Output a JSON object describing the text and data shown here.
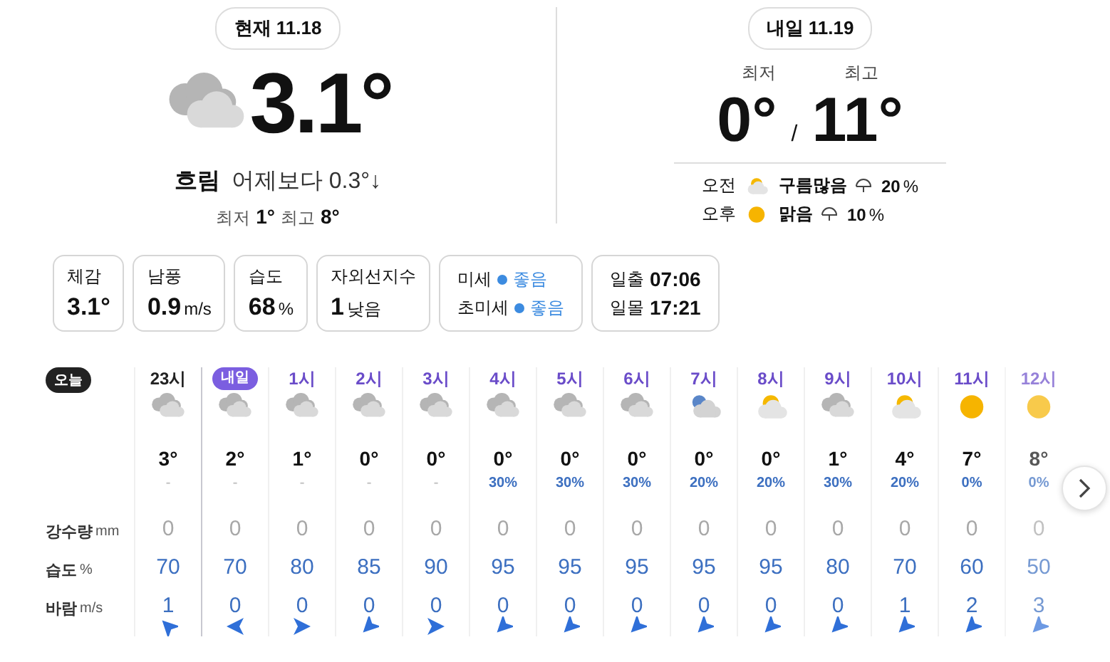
{
  "today": {
    "date_label": "현재 11.18",
    "temp": "3.1°",
    "icon": {
      "kind": "cloudy"
    },
    "condition": "흐림",
    "compare": "어제보다 0.3°↓",
    "low_label": "최저",
    "low": "1°",
    "high_label": "최고",
    "high": "8°"
  },
  "tomorrow": {
    "date_label": "내일 11.19",
    "low_label": "최저",
    "high_label": "최고",
    "low": "0°",
    "separator": "/",
    "high": "11°",
    "periods": [
      {
        "label": "오전",
        "icon": {
          "kind": "partly-cloudy"
        },
        "condition": "구름많음",
        "chance": "20",
        "unit": "%"
      },
      {
        "label": "오후",
        "icon": {
          "kind": "sunny"
        },
        "condition": "맑음",
        "chance": "10",
        "unit": "%"
      }
    ]
  },
  "cards": [
    {
      "kind": "single",
      "label": "체감",
      "value": "3.1°"
    },
    {
      "kind": "single",
      "label": "남풍",
      "value": "0.9",
      "unit": "m/s"
    },
    {
      "kind": "single",
      "label": "습도",
      "value": "68",
      "unit": "%"
    },
    {
      "kind": "single",
      "label": "자외선지수",
      "value": "1",
      "unit": "낮음"
    },
    {
      "kind": "air",
      "rows": [
        {
          "label": "미세",
          "value": "좋음"
        },
        {
          "label": "초미세",
          "value": "좋음"
        }
      ]
    },
    {
      "kind": "sun",
      "rows": [
        {
          "label": "일출",
          "value": "07:06"
        },
        {
          "label": "일몰",
          "value": "17:21"
        }
      ]
    }
  ],
  "hourly": {
    "day_tag": "오늘",
    "row_labels": [
      {
        "label": "강수량",
        "unit": "mm"
      },
      {
        "label": "습도",
        "unit": "%"
      },
      {
        "label": "바람",
        "unit": "m/s"
      }
    ],
    "columns": [
      {
        "kind": "hour",
        "time": "23시",
        "tomorrow": false,
        "faded": false,
        "icon": {
          "kind": "cloudy"
        },
        "temp": "3°",
        "chance": "-",
        "rain": "0",
        "humidity": "70",
        "wind": "1",
        "wind_arrow": {
          "kind": "nw"
        }
      },
      {
        "kind": "tag",
        "time": "내일",
        "faded": false,
        "icon": {
          "kind": "cloudy"
        },
        "temp": "2°",
        "chance": "-",
        "rain": "0",
        "humidity": "70",
        "wind": "0",
        "wind_arrow": {
          "kind": "w"
        }
      },
      {
        "kind": "hour",
        "time": "1시",
        "tomorrow": true,
        "faded": false,
        "icon": {
          "kind": "cloudy"
        },
        "temp": "1°",
        "chance": "-",
        "rain": "0",
        "humidity": "80",
        "wind": "0",
        "wind_arrow": {
          "kind": "e"
        }
      },
      {
        "kind": "hour",
        "time": "2시",
        "tomorrow": true,
        "faded": false,
        "icon": {
          "kind": "cloudy"
        },
        "temp": "0°",
        "chance": "-",
        "rain": "0",
        "humidity": "85",
        "wind": "0",
        "wind_arrow": {
          "kind": "sw"
        }
      },
      {
        "kind": "hour",
        "time": "3시",
        "tomorrow": true,
        "faded": false,
        "icon": {
          "kind": "cloudy"
        },
        "temp": "0°",
        "chance": "-",
        "rain": "0",
        "humidity": "90",
        "wind": "0",
        "wind_arrow": {
          "kind": "e"
        }
      },
      {
        "kind": "hour",
        "time": "4시",
        "tomorrow": true,
        "faded": false,
        "icon": {
          "kind": "cloudy"
        },
        "temp": "0°",
        "chance": "30%",
        "rain": "0",
        "humidity": "95",
        "wind": "0",
        "wind_arrow": {
          "kind": "sw"
        }
      },
      {
        "kind": "hour",
        "time": "5시",
        "tomorrow": true,
        "faded": false,
        "icon": {
          "kind": "cloudy"
        },
        "temp": "0°",
        "chance": "30%",
        "rain": "0",
        "humidity": "95",
        "wind": "0",
        "wind_arrow": {
          "kind": "sw"
        }
      },
      {
        "kind": "hour",
        "time": "6시",
        "tomorrow": true,
        "faded": false,
        "icon": {
          "kind": "cloudy"
        },
        "temp": "0°",
        "chance": "30%",
        "rain": "0",
        "humidity": "95",
        "wind": "0",
        "wind_arrow": {
          "kind": "sw"
        }
      },
      {
        "kind": "hour",
        "time": "7시",
        "tomorrow": true,
        "faded": false,
        "icon": {
          "kind": "night-cloud"
        },
        "temp": "0°",
        "chance": "20%",
        "rain": "0",
        "humidity": "95",
        "wind": "0",
        "wind_arrow": {
          "kind": "sw"
        }
      },
      {
        "kind": "hour",
        "time": "8시",
        "tomorrow": true,
        "faded": false,
        "icon": {
          "kind": "partly-cloudy"
        },
        "temp": "0°",
        "chance": "20%",
        "rain": "0",
        "humidity": "95",
        "wind": "0",
        "wind_arrow": {
          "kind": "sw"
        }
      },
      {
        "kind": "hour",
        "time": "9시",
        "tomorrow": true,
        "faded": false,
        "icon": {
          "kind": "cloudy"
        },
        "temp": "1°",
        "chance": "30%",
        "rain": "0",
        "humidity": "80",
        "wind": "0",
        "wind_arrow": {
          "kind": "sw"
        }
      },
      {
        "kind": "hour",
        "time": "10시",
        "tomorrow": true,
        "faded": false,
        "icon": {
          "kind": "partly-cloudy"
        },
        "temp": "4°",
        "chance": "20%",
        "rain": "0",
        "humidity": "70",
        "wind": "1",
        "wind_arrow": {
          "kind": "sw"
        }
      },
      {
        "kind": "hour",
        "time": "11시",
        "tomorrow": true,
        "faded": false,
        "icon": {
          "kind": "sunny"
        },
        "temp": "7°",
        "chance": "0%",
        "rain": "0",
        "humidity": "60",
        "wind": "2",
        "wind_arrow": {
          "kind": "sw"
        }
      },
      {
        "kind": "hour",
        "time": "12시",
        "tomorrow": true,
        "faded": true,
        "icon": {
          "kind": "sunny"
        },
        "temp": "8°",
        "chance": "0%",
        "rain": "0",
        "humidity": "50",
        "wind": "3",
        "wind_arrow": {
          "kind": "sw"
        }
      }
    ]
  }
}
